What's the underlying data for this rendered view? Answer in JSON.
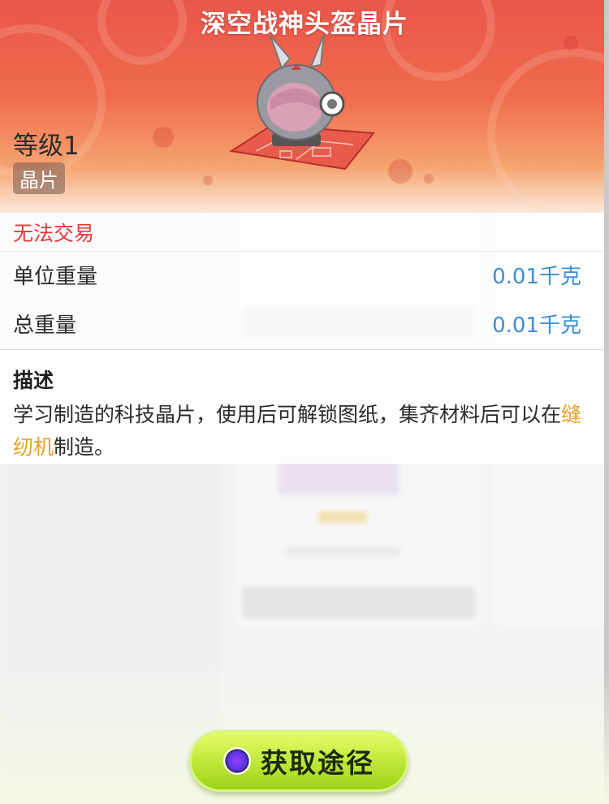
{
  "item": {
    "title": "深空战神头盔晶片",
    "level": "等级1",
    "category": "晶片",
    "trade_status": "无法交易",
    "stats": [
      {
        "label": "单位重量",
        "value": "0.01千克"
      },
      {
        "label": "总重量",
        "value": "0.01千克"
      }
    ],
    "description": {
      "heading": "描述",
      "text_before": "学习制造的科技晶片，使用后可解锁图纸，集齐材料后可以在",
      "highlight": "缝纫机",
      "text_after": "制造。"
    }
  },
  "actions": {
    "obtain_label": "获取途径"
  },
  "colors": {
    "header_top": "#e9564a",
    "trade_red": "#e03a3a",
    "value_blue": "#3c8fd6",
    "highlight_orange": "#e6a224",
    "button_green": "#bde636"
  },
  "icons": {
    "obtain": "orb-icon",
    "item": "helmet-chip-icon"
  }
}
